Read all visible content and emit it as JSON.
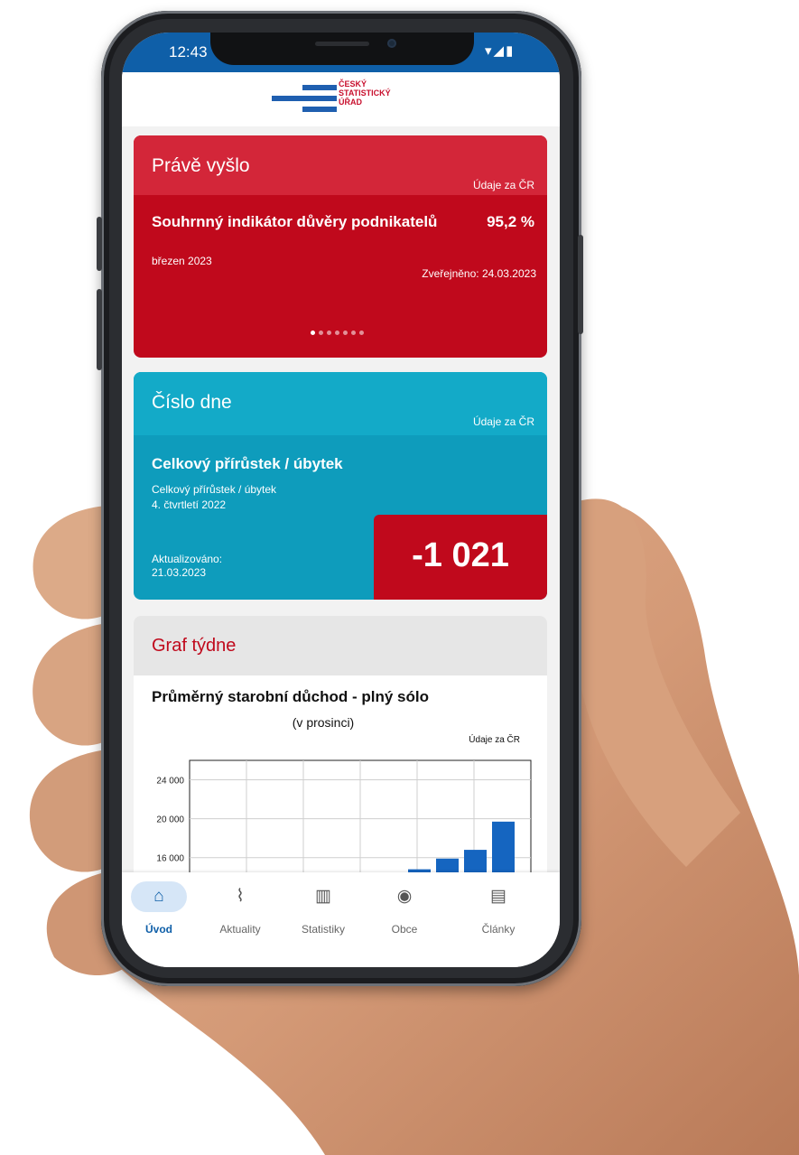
{
  "status_bar": {
    "time": "12:43",
    "indicators": "▾◢▮"
  },
  "logo": {
    "line1": "ČESKÝ",
    "line2": "STATISTICKÝ",
    "line3": "ÚŘAD"
  },
  "prave_vyslo": {
    "title": "Právě vyšlo",
    "scope": "Údaje za ČR",
    "indicator": "Souhrnný indikátor důvěry podnikatelů",
    "value": "95,2 %",
    "period": "březen 2023",
    "published": "Zveřejněno: 24.03.2023",
    "carousel_pages": 7,
    "carousel_active": 1
  },
  "cislo_dne": {
    "title": "Číslo dne",
    "scope": "Údaje za ČR",
    "name": "Celkový přírůstek / úbytek",
    "desc_line1": "Celkový přírůstek / úbytek",
    "desc_line2": "4. čtvrtletí 2022",
    "updated_label": "Aktualizováno:",
    "updated_date": "21.03.2023",
    "value": "-1 021"
  },
  "graf_tydne": {
    "title": "Graf týdne",
    "chart_title": "Průměrný starobní důchod - plný sólo",
    "chart_subtitle": "(v prosinci)",
    "scope": "Údaje za ČR"
  },
  "chart_data": {
    "type": "bar",
    "title": "Průměrný starobní důchod - plný sólo",
    "subtitle": "(v prosinci)",
    "yticks": [
      "24 000",
      "20 000",
      "16 000"
    ],
    "ylim": [
      13000,
      26000
    ],
    "values": [
      14800,
      15900,
      16800,
      19700
    ],
    "bar_color": "#1565c0"
  },
  "nav": [
    {
      "label": "Úvod",
      "icon": "home-icon",
      "glyph": "⌂",
      "active": true
    },
    {
      "label": "Aktuality",
      "icon": "rss-icon",
      "glyph": "⌇",
      "active": false
    },
    {
      "label": "Statistiky",
      "icon": "bar-chart-icon",
      "glyph": "▥",
      "active": false
    },
    {
      "label": "Obce",
      "icon": "map-pin-icon",
      "glyph": "◉",
      "active": false
    },
    {
      "label": "Články",
      "icon": "article-icon",
      "glyph": "▤",
      "active": false
    }
  ]
}
